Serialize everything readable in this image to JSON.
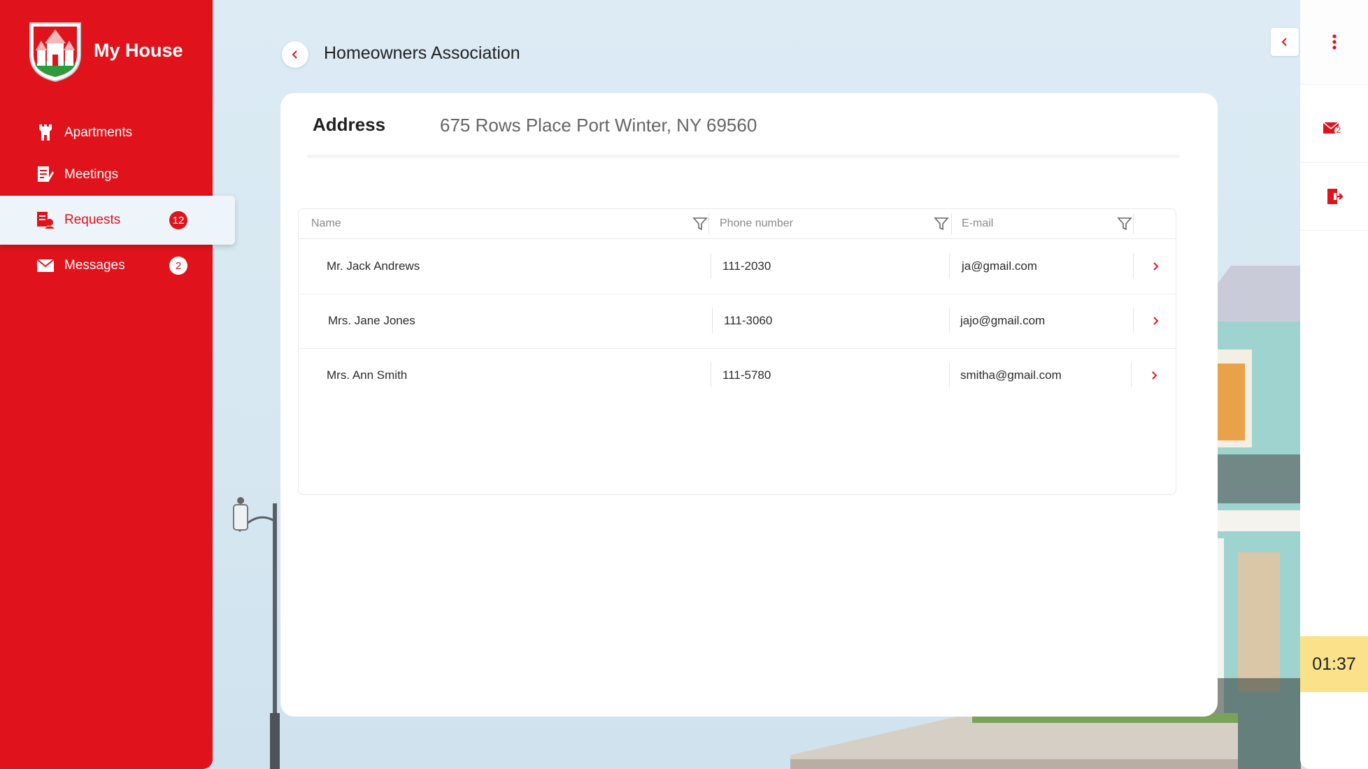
{
  "brand": {
    "title": "My House"
  },
  "sidebar": {
    "items": [
      {
        "label": "Apartments",
        "icon": "tower-icon"
      },
      {
        "label": "Meetings",
        "icon": "document-edit-icon"
      },
      {
        "label": "Requests",
        "icon": "request-document-icon",
        "badge": "12"
      },
      {
        "label": "Messages",
        "icon": "envelope-icon",
        "badge": "2"
      }
    ]
  },
  "header": {
    "title": "Homeowners Association"
  },
  "address": {
    "label": "Address",
    "value": "675 Rows Place Port Winter, NY 69560"
  },
  "table": {
    "columns": [
      "Name",
      "Phone number",
      "E-mail"
    ],
    "rows": [
      {
        "name": "Mr. Jack Andrews",
        "phone": "111-2030",
        "email": "ja@gmail.com"
      },
      {
        "name": "Mrs. Jane Jones",
        "phone": "111-3060",
        "email": "jajo@gmail.com"
      },
      {
        "name": "Mrs. Ann Smith",
        "phone": "111-5780",
        "email": "smitha@gmail.com"
      }
    ]
  },
  "rail": {
    "mail_count": "2",
    "timer": "01:37"
  },
  "colors": {
    "brand_red": "#e0121b",
    "timer_bg": "#fbe28a",
    "page_bg": "#dcebf4"
  }
}
